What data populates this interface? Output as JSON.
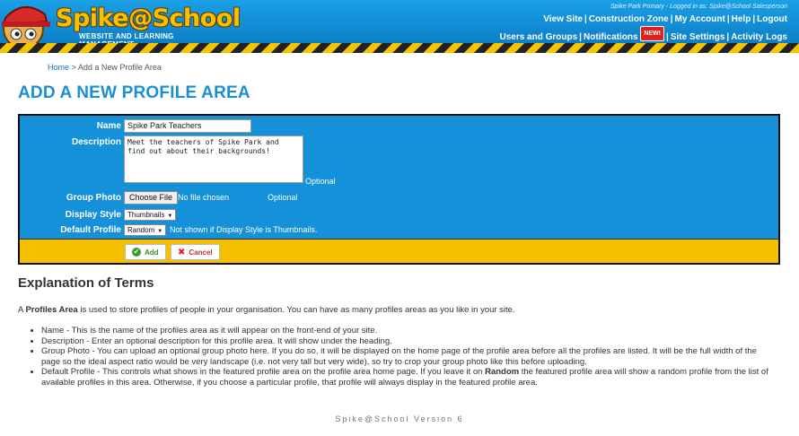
{
  "header": {
    "logo_text": "Spike@School",
    "logo_tagline": "WEBSITE AND LEARNING MANAGEMENT",
    "logged_in": "Spike Park Primary - Logged in as: Spike@School Salesperson",
    "nav_row1": [
      "View Site",
      "Construction Zone",
      "My Account",
      "Help",
      "Logout"
    ],
    "nav_row2": [
      "Users and Groups",
      "Notifications",
      "Site Settings",
      "Activity Logs"
    ],
    "new_badge": "NEW!"
  },
  "breadcrumb": {
    "home": "Home",
    "separator": ">",
    "current": "Add a New Profile Area"
  },
  "page_title": "ADD A NEW PROFILE AREA",
  "form": {
    "name_label": "Name",
    "name_value": "Spike Park Teachers",
    "description_label": "Description",
    "description_value": "Meet the teachers of Spike Park and find out about their backgrounds!",
    "optional": "Optional",
    "group_photo_label": "Group Photo",
    "choose_file": "Choose File",
    "no_file": "No file chosen",
    "display_style_label": "Display Style",
    "display_style_value": "Thumbnails",
    "default_profile_label": "Default Profile",
    "default_profile_value": "Random",
    "default_profile_hint": "Not shown if Display Style is Thumbnails.",
    "add_button": "Add",
    "cancel_button": "Cancel"
  },
  "explanation": {
    "title": "Explanation of Terms",
    "intro_pre": "A ",
    "intro_bold": "Profiles Area",
    "intro_post": " is used to store profiles of people in your organisation. You can have as many profiles areas as you like in your site.",
    "items": [
      "Name - This is the name of the profiles area as it will appear on the front-end of your site.",
      "Description - Enter an optional description for this profile area. It will show under the heading.",
      "Group Photo - You can upload an optional group photo here. If you do so, it will be displayed on the home page of the profile area before all the profiles are listed. It will be the full width of the page so the ideal aspect ratio would be very landscape (i.e. not very tall but very wide), so try to crop your group photo like this before uploading."
    ],
    "last_item_pre": "Default Profile - This controls what shows in the featured profile area on the profile area home page. If you leave it on ",
    "last_item_bold": "Random",
    "last_item_post": " the featured profile area will show a random profile from the list of available profiles in this area. Otherwise, if you choose a particular profile, that profile will always display in the featured profile area."
  },
  "footer": {
    "version": "Spike@School Version 6"
  },
  "colors": {
    "header_blue": "#0a78c2",
    "panel_blue": "#1491d9",
    "footer_yellow": "#f6c000",
    "title_blue": "#1a8fd6"
  }
}
